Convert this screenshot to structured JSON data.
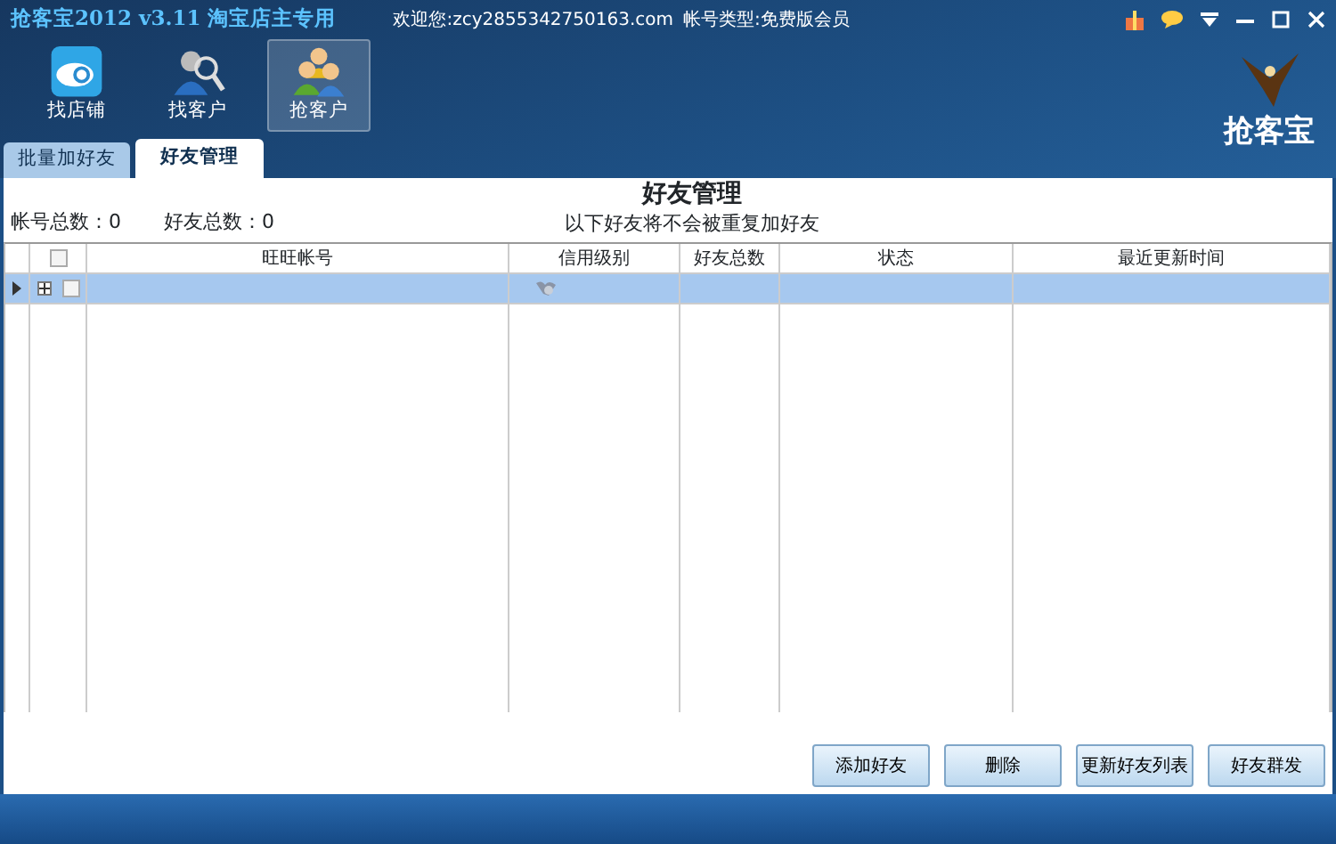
{
  "window": {
    "title": "抢客宝2012 v3.11 淘宝店主专用",
    "welcome": "欢迎您:zcy2855342750163.com",
    "account_type": "帐号类型:免费版会员"
  },
  "nav": [
    {
      "label": "找店铺",
      "selected": false
    },
    {
      "label": "找客户",
      "selected": false
    },
    {
      "label": "抢客户",
      "selected": true
    }
  ],
  "logo": "抢客宝",
  "tabs": [
    {
      "label": "批量加好友",
      "selected": false
    },
    {
      "label": "好友管理",
      "selected": true
    }
  ],
  "heading": "好友管理",
  "subheading": "以下好友将不会被重复加好友",
  "counts": [
    "帐号总数：0",
    "好友总数：0"
  ],
  "table": {
    "header_checked": false,
    "columns": [
      "旺旺帐号",
      "信用级别",
      "好友总数",
      "状态",
      "最近更新时间"
    ],
    "rows": [
      {
        "selected": true,
        "expanded": false,
        "checked": false
      }
    ]
  },
  "buttons": [
    "添加好友",
    "删除",
    "更新好友列表",
    "好友群发"
  ]
}
